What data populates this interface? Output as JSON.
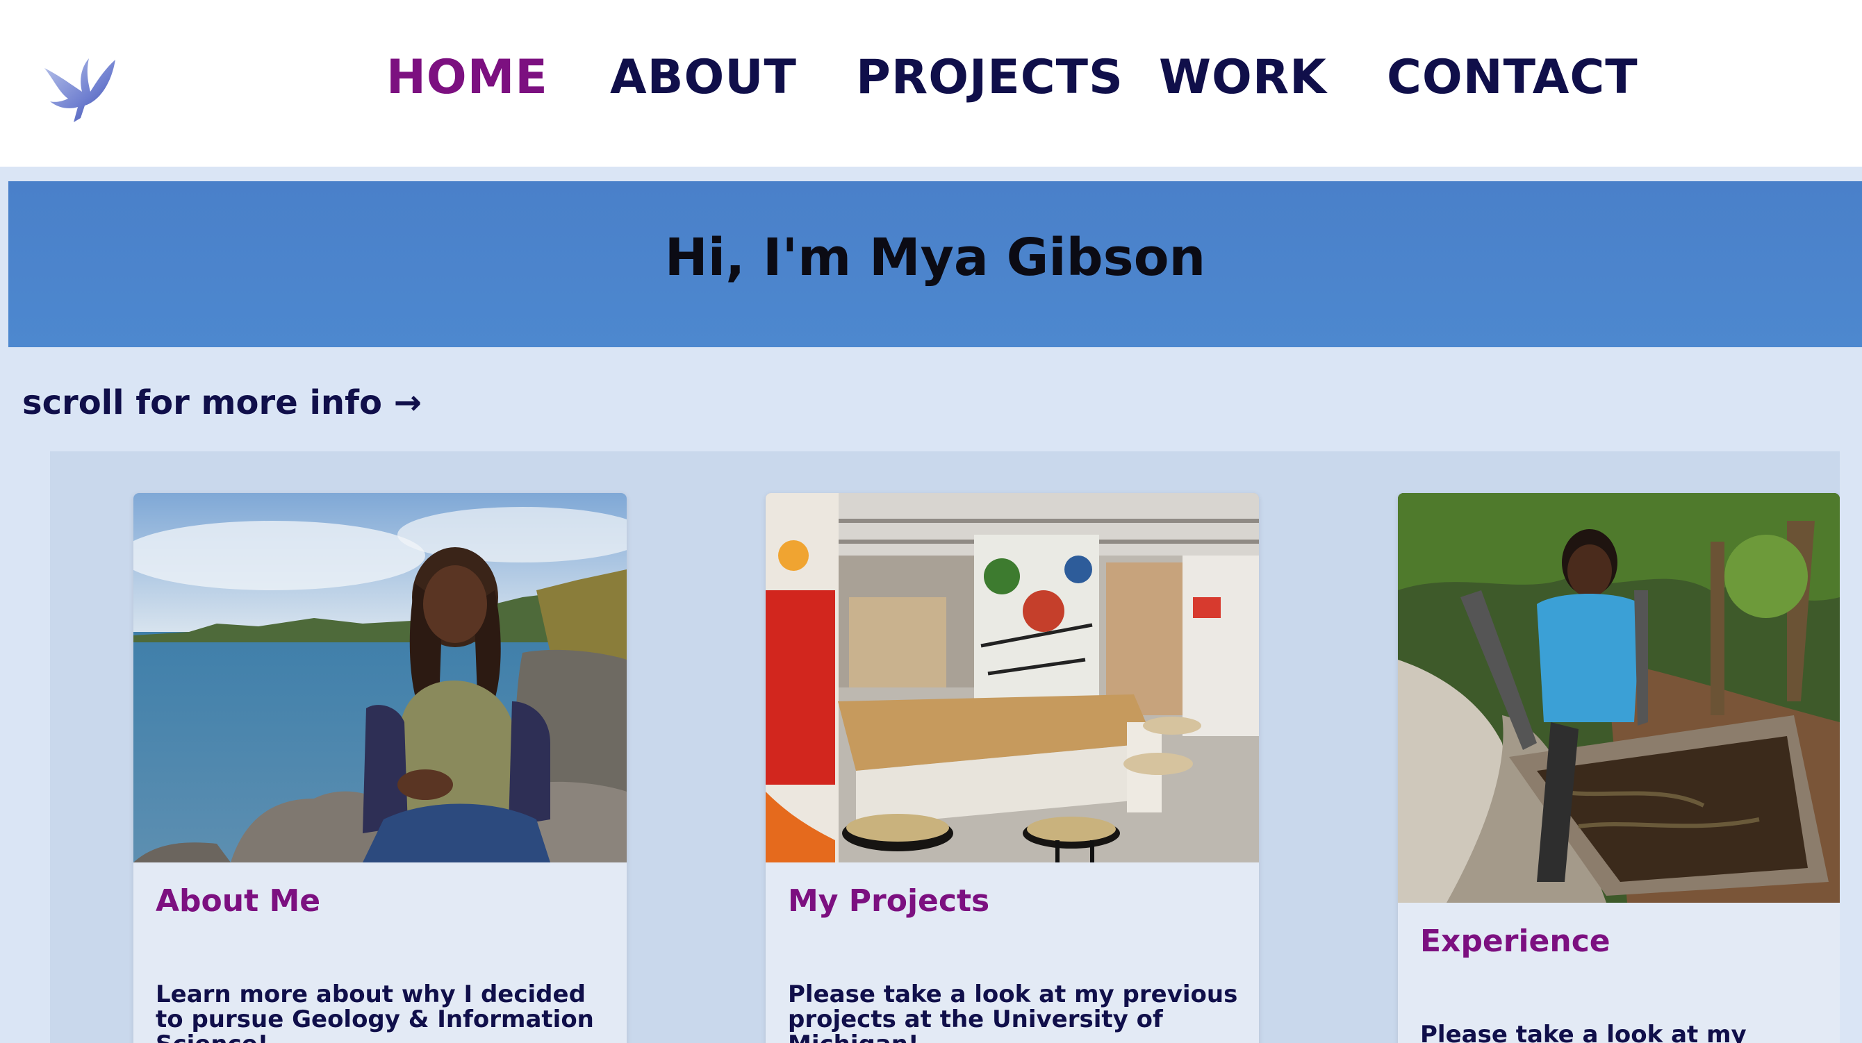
{
  "nav": {
    "items": [
      {
        "label": "HOME",
        "active": true
      },
      {
        "label": "ABOUT",
        "active": false
      },
      {
        "label": "PROJECTS",
        "active": false
      },
      {
        "label": "WORK",
        "active": false
      },
      {
        "label": "CONTACT",
        "active": false
      }
    ],
    "logo_icon": "dove-icon"
  },
  "hero": {
    "title": "Hi, I'm Mya Gibson"
  },
  "scroll_hint": "scroll for more info →",
  "cards": [
    {
      "title": "About Me",
      "text": "Learn more about why I decided to pursue Geology & Information Science!",
      "image": "photo of a person seated on rocks by a lake"
    },
    {
      "title": "My Projects",
      "text": "Please take a look at my previous projects at the University of Michigan!",
      "image": "photo of a makerspace with graffiti-covered walls and workbenches"
    },
    {
      "title": "Experience",
      "text": "Please take a look at my previous work experience!",
      "image": "photo of a person pushing a wheelbarrow in a garden"
    }
  ],
  "colors": {
    "nav_text": "#100f4a",
    "nav_active": "#7c1080",
    "hero_bg": "#4a80c9",
    "page_bg": "#dae5f5",
    "card_title": "#7c1080"
  }
}
